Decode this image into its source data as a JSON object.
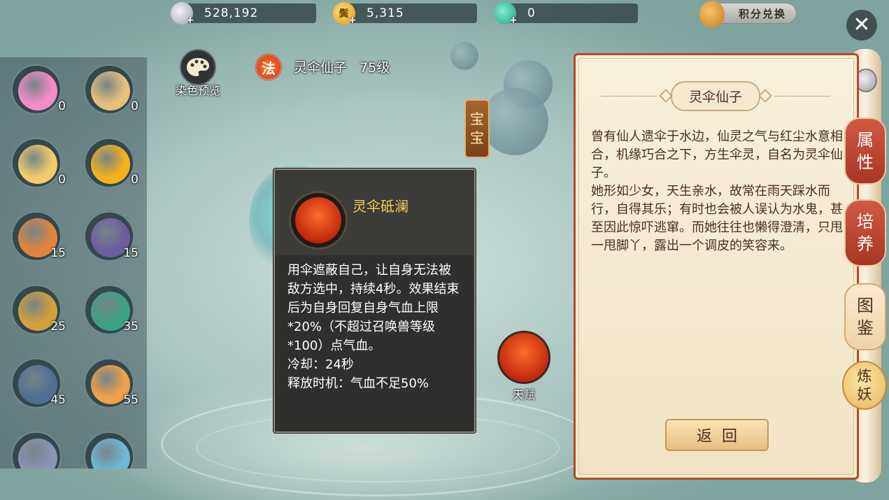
{
  "currencies": [
    {
      "icon": "silver-coin-icon",
      "value": "528,192",
      "color": "#c9ccd6"
    },
    {
      "icon": "gold-coin-icon",
      "value": "5,315",
      "color": "#f2b227",
      "glyph": "鬓"
    },
    {
      "icon": "jade-icon",
      "value": "0",
      "color": "#3fc3a6"
    }
  ],
  "exchange_label": "积分兑换",
  "close_glyph": "✕",
  "dye_preview_label": "染色预览",
  "pet": {
    "type_badge": "法",
    "name": "灵伞仙子",
    "level": "75级"
  },
  "baobao_tab": [
    "宝",
    "宝"
  ],
  "pet_list": [
    {
      "count": "0",
      "color": "#f58cc8"
    },
    {
      "count": "0",
      "color": "#e7c07a"
    },
    {
      "count": "0",
      "color": "#f2cc6a"
    },
    {
      "count": "0",
      "color": "#f5b21c"
    },
    {
      "count": "15",
      "color": "#e2833d"
    },
    {
      "count": "15",
      "color": "#6d5d9c"
    },
    {
      "count": "25",
      "color": "#d5a03b"
    },
    {
      "count": "35",
      "color": "#3aa383"
    },
    {
      "count": "45",
      "color": "#4f6f93"
    },
    {
      "count": "55",
      "color": "#f1a04a"
    },
    {
      "count": "",
      "color": "#8a95b5"
    },
    {
      "count": "",
      "color": "#6cb9d8"
    }
  ],
  "skill": {
    "name": "灵伞砥澜",
    "description": "用伞遮蔽自己，让自身无法被敌方选中，持续4秒。效果结束后为自身回复自身气血上限*20%（不超过召唤兽等级*100）点气血。",
    "cooldown": "冷却：24秒",
    "trigger": "释放时机：气血不足50%"
  },
  "talent_label": "天赋",
  "info_panel": {
    "title": "灵伞仙子",
    "text": "曾有仙人遗伞于水边，仙灵之气与红尘水意相合，机缘巧合之下，方生伞灵，自名为灵伞仙子。\n她形如少女，天生亲水，故常在雨天踩水而行，自得其乐；有时也会被人误认为水鬼，甚至因此惊吓逃窜。而她往往也懒得澄清，只甩一甩脚丫，露出一个调皮的笑容来。",
    "back_label": "返回"
  },
  "side_tabs": [
    {
      "label": [
        "属",
        "性"
      ],
      "style": "red"
    },
    {
      "label": [
        "培",
        "养"
      ],
      "style": "red"
    },
    {
      "label": [
        "图",
        "鉴"
      ],
      "style": "pale"
    },
    {
      "label": [
        "炼",
        "妖"
      ],
      "style": "gold"
    }
  ]
}
